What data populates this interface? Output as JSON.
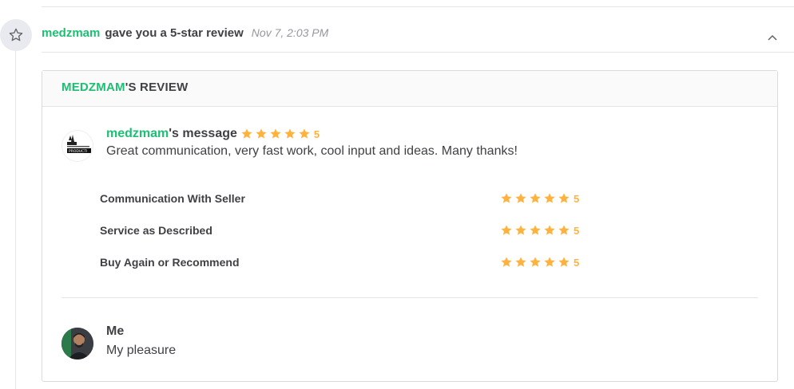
{
  "event": {
    "user": "medzmam",
    "text": "gave you a 5-star review",
    "time": "Nov 7, 2:03 PM",
    "icon": "star-outline-icon"
  },
  "review": {
    "header_user": "MEDZMAM",
    "header_rest": "'S REVIEW",
    "buyer": {
      "user": "medzmam",
      "suffix": "'s message",
      "rating": 5,
      "rating_text": "5",
      "message": "Great communication, very fast work, cool input and ideas. Many thanks!"
    },
    "ratings": [
      {
        "label": "Communication With Seller",
        "value": 5,
        "value_text": "5"
      },
      {
        "label": "Service as Described",
        "value": 5,
        "value_text": "5"
      },
      {
        "label": "Buy Again or Recommend",
        "value": 5,
        "value_text": "5"
      }
    ],
    "seller": {
      "name": "Me",
      "message": "My pleasure"
    }
  },
  "colors": {
    "accent": "#1dbf73",
    "star": "#ffb33e",
    "text": "#404145",
    "muted": "#95979d"
  }
}
